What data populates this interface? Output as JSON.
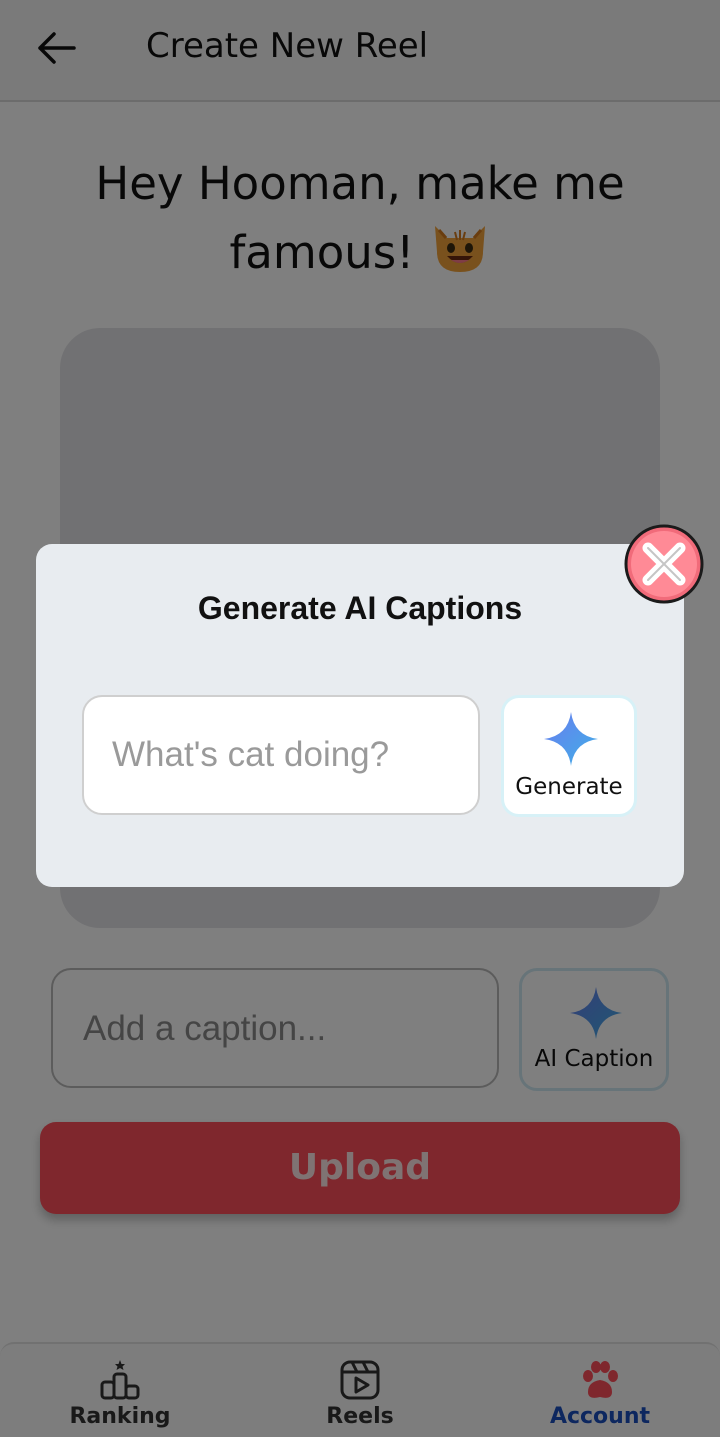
{
  "header": {
    "title": "Create New Reel"
  },
  "headline": {
    "text": "Hey Hooman, make me famous!"
  },
  "caption": {
    "placeholder": "Add a caption...",
    "ai_button_label": "AI Caption"
  },
  "upload": {
    "label": "Upload"
  },
  "nav": {
    "items": [
      {
        "label": "Ranking",
        "icon": "ranking-icon"
      },
      {
        "label": "Reels",
        "icon": "reels-icon"
      },
      {
        "label": "Account",
        "icon": "paw-icon",
        "active": true
      }
    ]
  },
  "modal": {
    "title": "Generate AI Captions",
    "input_placeholder": "What's cat doing?",
    "generate_label": "Generate",
    "close_icon": "close-icon"
  },
  "colors": {
    "accent": "#ff4f5b",
    "active_nav": "#1a4fbf",
    "spark_gradient": [
      "#6a7cf0",
      "#3fb0e6"
    ]
  }
}
